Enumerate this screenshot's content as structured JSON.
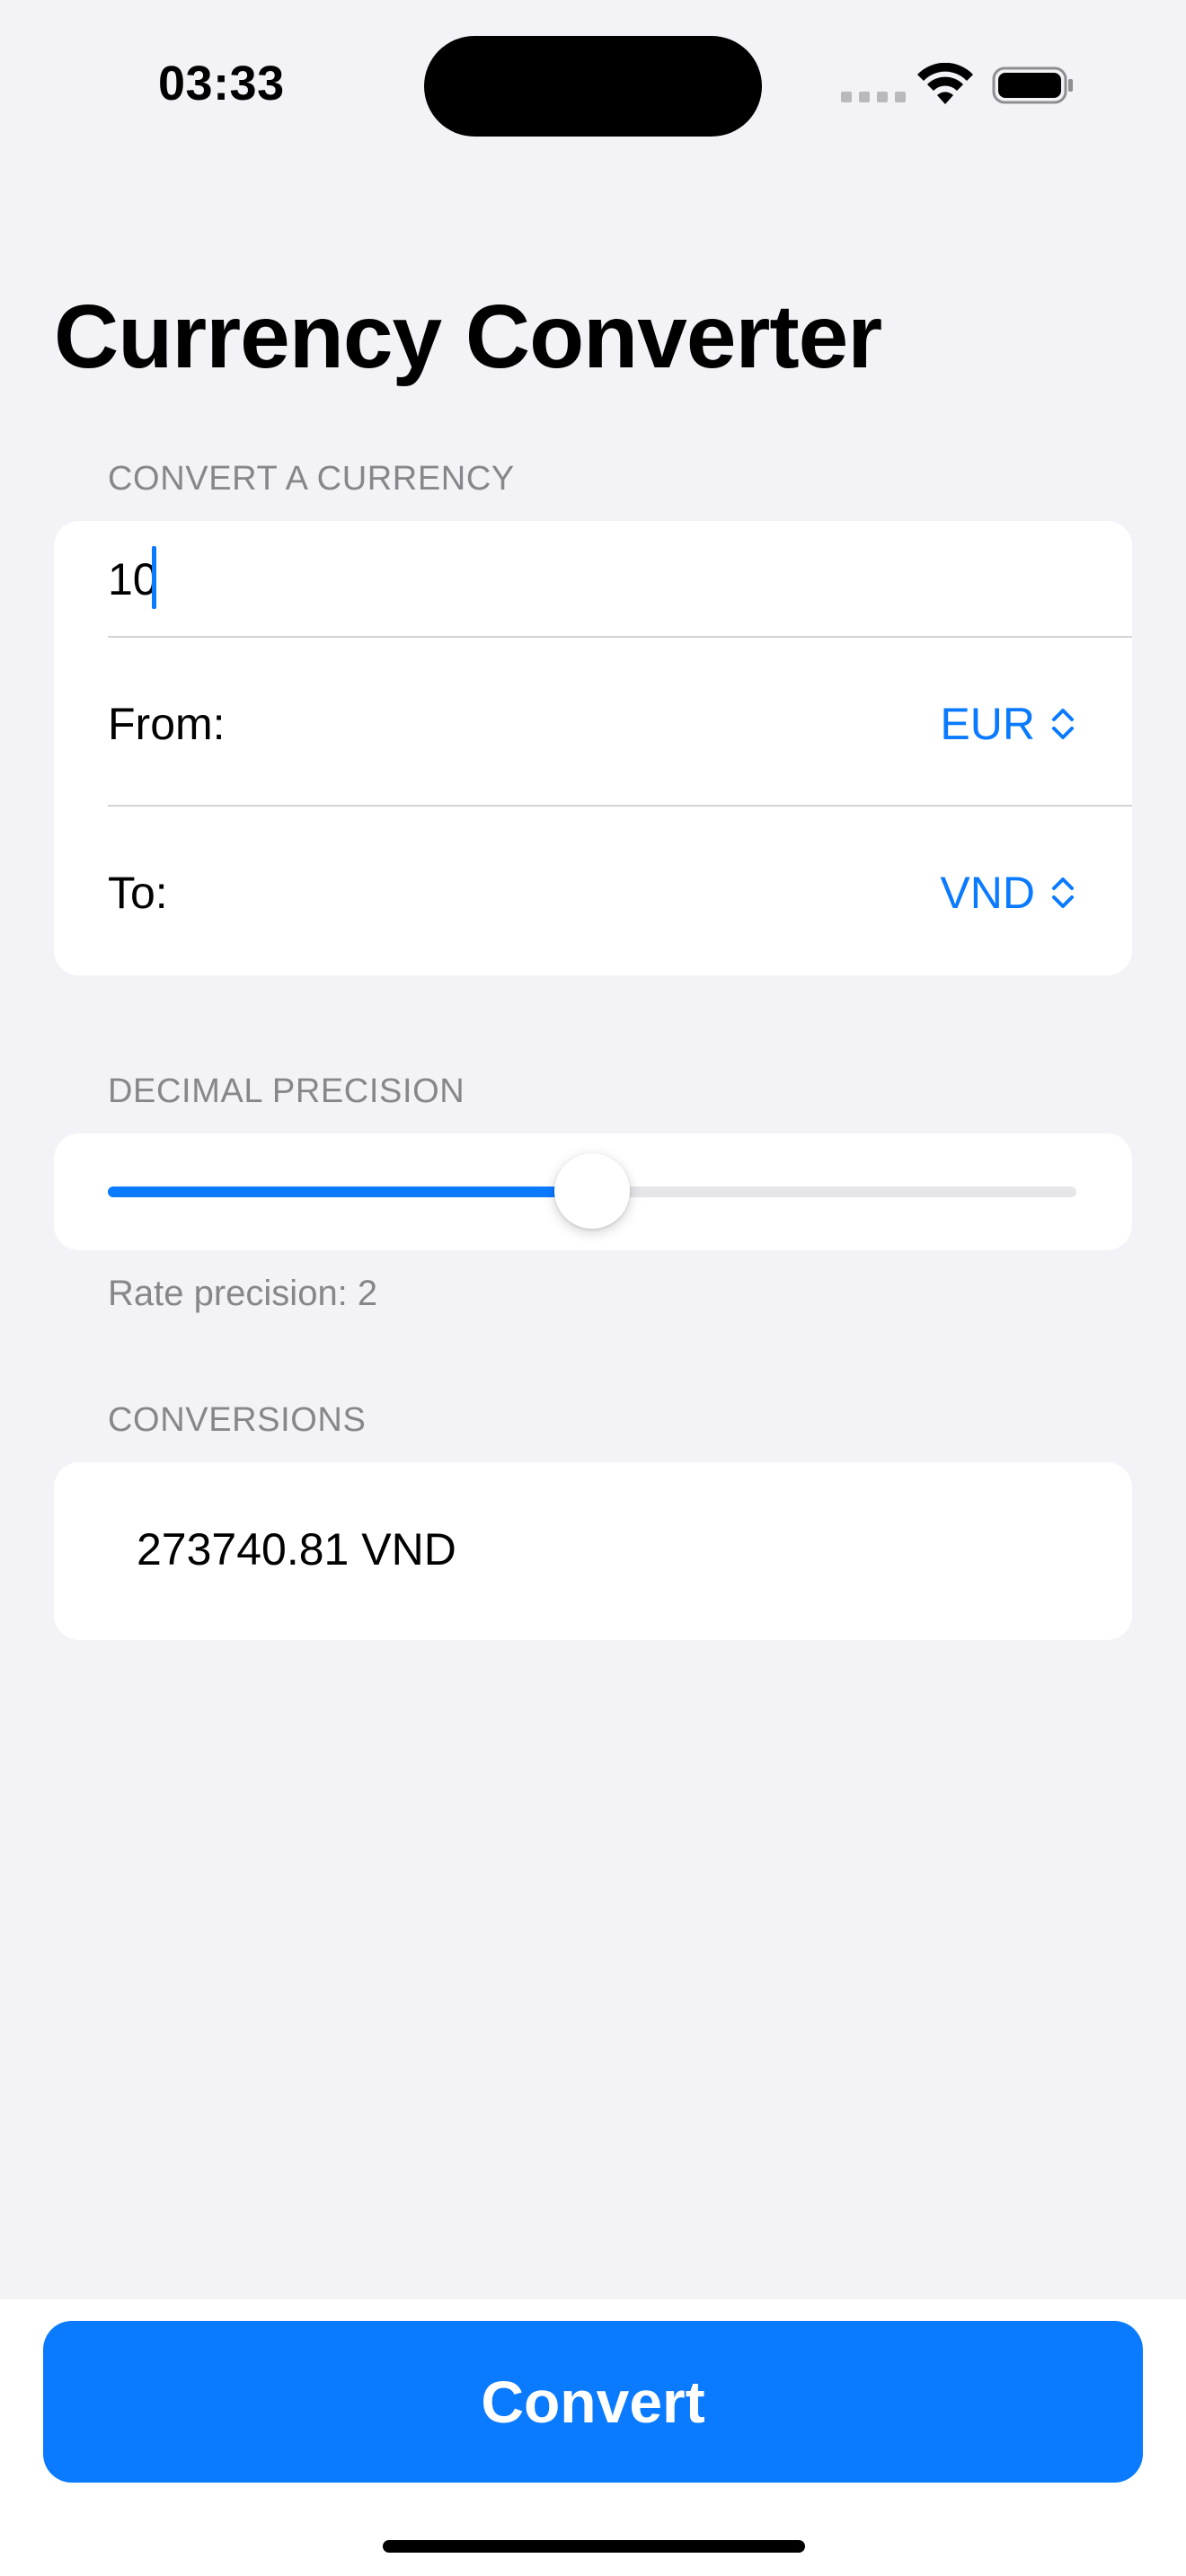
{
  "status_bar": {
    "time": "03:33"
  },
  "page": {
    "title": "Currency Converter"
  },
  "convert_section": {
    "header": "CONVERT A CURRENCY",
    "amount_value": "10",
    "from_label": "From:",
    "from_value": "EUR",
    "to_label": "To:",
    "to_value": "VND"
  },
  "precision_section": {
    "header": "DECIMAL PRECISION",
    "slider_fraction": 0.5,
    "footnote": "Rate precision: 2"
  },
  "conversions_section": {
    "header": "CONVERSIONS",
    "result": "273740.81 VND"
  },
  "actions": {
    "convert_label": "Convert"
  },
  "colors": {
    "accent": "#0A7AFF",
    "background": "#F2F2F7",
    "card": "#FFFFFF",
    "secondary_text": "#86868B"
  }
}
